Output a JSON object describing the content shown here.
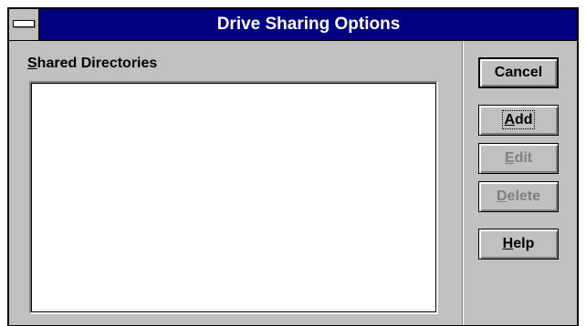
{
  "window": {
    "title": "Drive Sharing Options"
  },
  "list": {
    "label_mnemonic": "S",
    "label_rest": "hared Directories",
    "items": []
  },
  "buttons": {
    "cancel": {
      "label": "Cancel",
      "enabled": true
    },
    "add": {
      "mnemonic": "A",
      "rest": "dd",
      "enabled": true,
      "focused": true
    },
    "edit": {
      "mnemonic": "E",
      "rest": "dit",
      "enabled": false
    },
    "delete": {
      "mnemonic": "D",
      "rest": "elete",
      "enabled": false
    },
    "help": {
      "mnemonic": "H",
      "rest": "elp",
      "enabled": true
    }
  },
  "colors": {
    "titlebar": "#000080",
    "face": "#c0c0c0",
    "disabled_text": "#808080"
  },
  "icons": {
    "system_menu": "system-menu-icon"
  }
}
